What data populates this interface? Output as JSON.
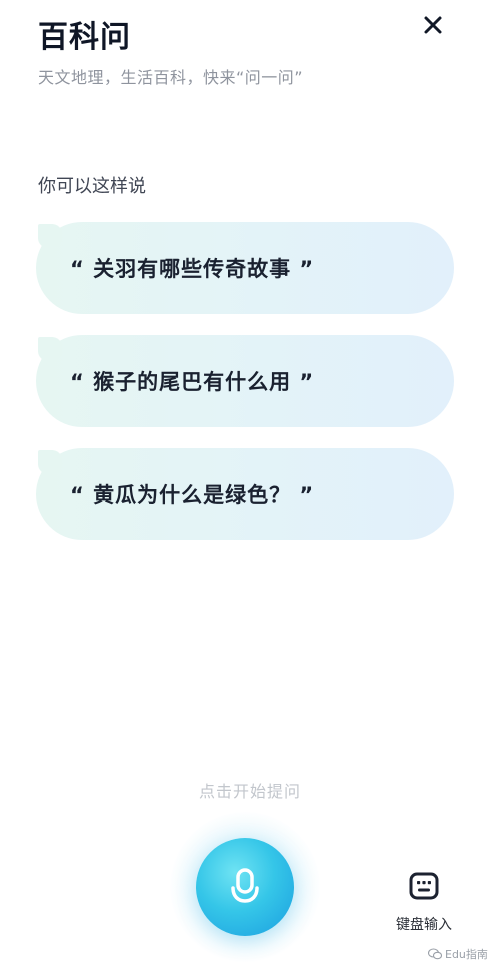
{
  "header": {
    "title": "百科问",
    "subtitle": "天文地理，生活百科，快来“问一问”",
    "close_icon": "close-icon"
  },
  "hint_heading": "你可以这样说",
  "suggestions": [
    {
      "text": "“ 关羽有哪些传奇故事 ”"
    },
    {
      "text": "“ 猴子的尾巴有什么用 ”"
    },
    {
      "text": "“ 黄瓜为什么是绿色？ ”"
    }
  ],
  "voice": {
    "hint": "点击开始提问",
    "icon": "microphone-icon"
  },
  "keyboard": {
    "label": "键盘输入",
    "icon": "keyboard-icon"
  },
  "watermark": {
    "text": "Edu指南",
    "icon": "wechat-logo"
  },
  "colors": {
    "accent": "#35c6e8",
    "bubble": "#e4f4f6",
    "title": "#0f1626",
    "muted": "#8f949e"
  }
}
